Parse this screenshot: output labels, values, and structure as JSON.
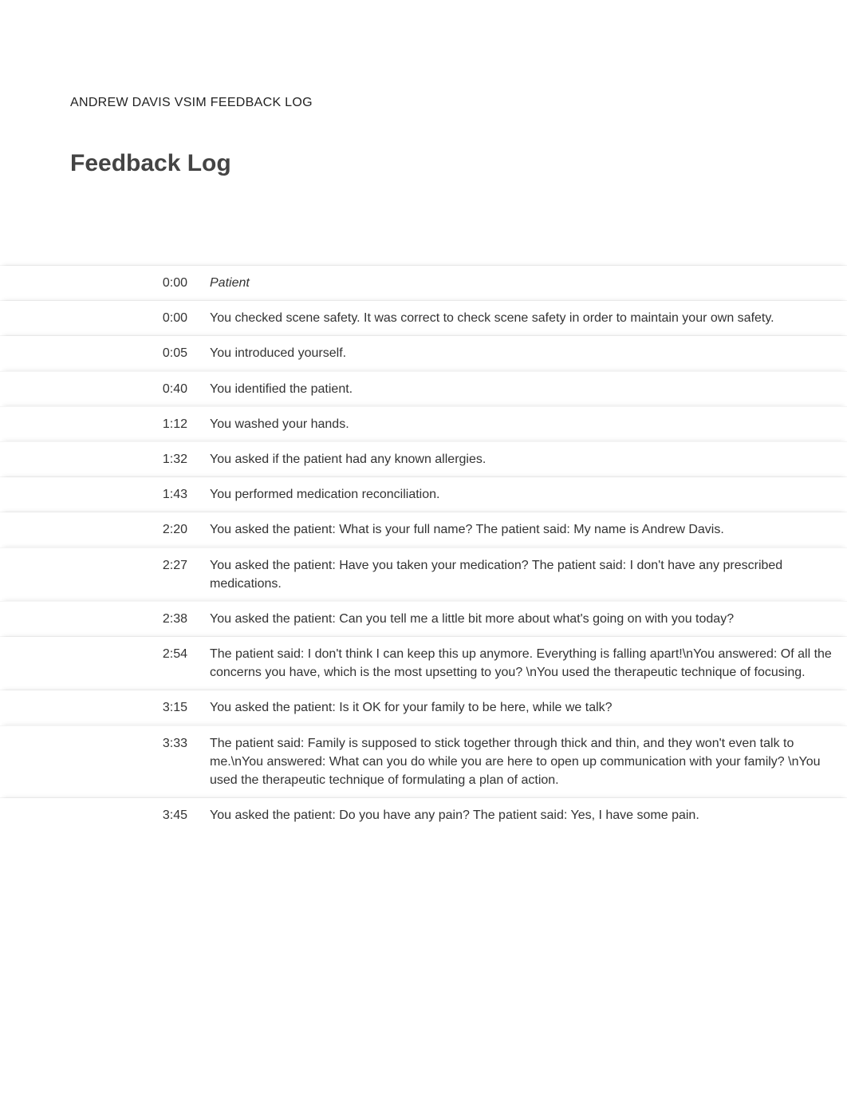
{
  "doc_title": "ANDREW DAVIS VSIM FEEDBACK LOG",
  "page_heading": "Feedback Log",
  "log": [
    {
      "time": "0:00",
      "desc": "Patient",
      "italic": true
    },
    {
      "time": "0:00",
      "desc": "You checked scene safety. It was correct to check scene safety in order to maintain your own safety."
    },
    {
      "time": "0:05",
      "desc": "You introduced yourself."
    },
    {
      "time": "0:40",
      "desc": "You identified the patient."
    },
    {
      "time": "1:12",
      "desc": "You washed your hands."
    },
    {
      "time": "1:32",
      "desc": "You asked if the patient had any known allergies."
    },
    {
      "time": "1:43",
      "desc": "You performed medication reconciliation."
    },
    {
      "time": "2:20",
      "desc": "You asked the patient: What is your full name? The patient said: My name is Andrew Davis."
    },
    {
      "time": "2:27",
      "desc": "You asked the patient: Have you taken your medication? The patient said: I don't have any prescribed medications."
    },
    {
      "time": "2:38",
      "desc": "You asked the patient: Can you tell me a little bit more about what's going on with you today?"
    },
    {
      "time": "2:54",
      "desc": "The patient said: I don't think I can keep this up anymore. Everything is falling apart!\\nYou answered: Of all the concerns you have, which is the most upsetting to you? \\nYou used the therapeutic technique of focusing."
    },
    {
      "time": "3:15",
      "desc": "You asked the patient: Is it OK for your family to be here, while we talk?"
    },
    {
      "time": "3:33",
      "desc": "The patient said: Family is supposed to stick together through thick and thin, and they won't even talk to me.\\nYou answered: What can you do while you are here to open up communication with your family? \\nYou used the therapeutic technique of formulating a plan of action."
    },
    {
      "time": "3:45",
      "desc": "You asked the patient: Do you have any pain? The patient said: Yes, I have some pain."
    }
  ]
}
